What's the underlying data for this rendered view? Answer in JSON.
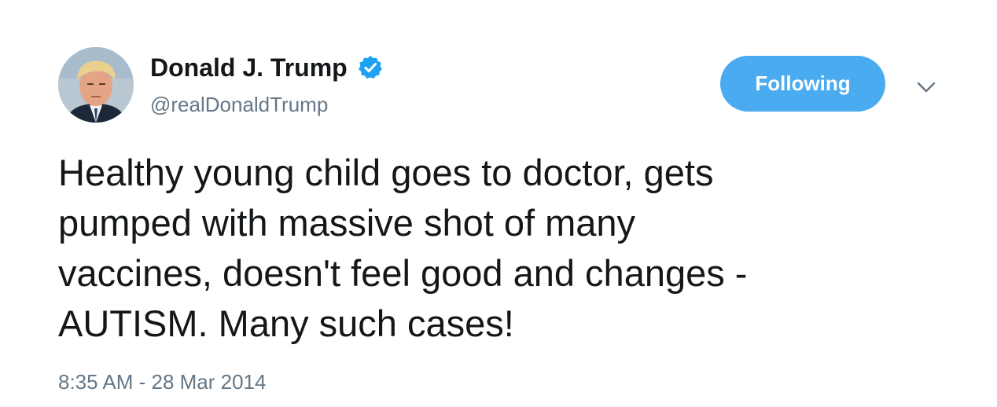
{
  "author": {
    "display_name": "Donald J. Trump",
    "handle": "@realDonaldTrump",
    "verified": true,
    "avatar_icon": "profile-photo-avatar",
    "verified_icon": "verified-badge-icon"
  },
  "actions": {
    "follow_label": "Following",
    "more_icon": "chevron-down-icon"
  },
  "tweet": {
    "lines": [
      "Healthy young child goes to doctor, gets",
      "pumped with massive shot of many",
      "vaccines, doesn't feel good and changes -",
      "AUTISM. Many such cases!"
    ],
    "timestamp": "8:35 AM - 28 Mar 2014"
  },
  "colors": {
    "accent": "#4aabf0",
    "verified": "#1da1f2",
    "text": "#14171a",
    "secondary_text": "#657786"
  }
}
